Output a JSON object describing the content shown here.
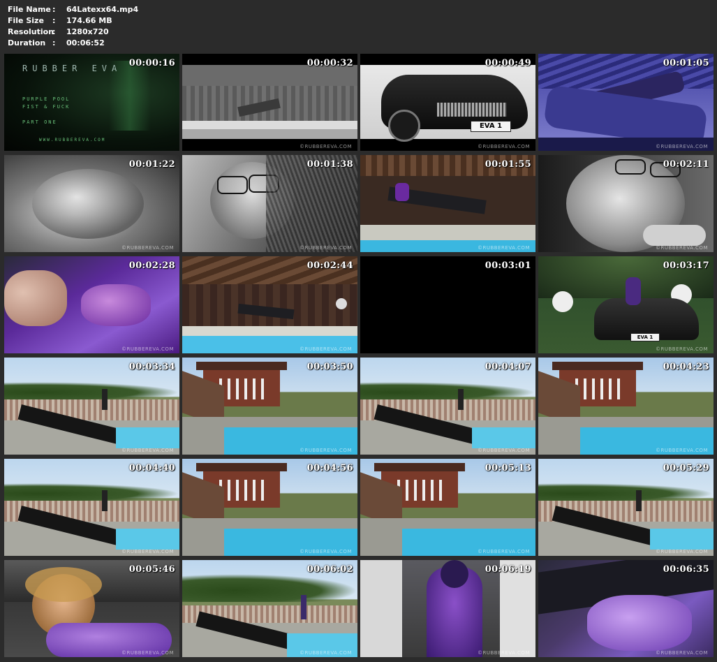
{
  "file_info": {
    "name_label": "File Name",
    "name": "64Latexx64.mp4",
    "size_label": "File Size",
    "size": "174.66 MB",
    "resolution_label": "Resolution",
    "resolution": "1280x720",
    "duration_label": "Duration",
    "duration": "00:06:52",
    "separator": ":"
  },
  "title_card": {
    "title": "RUBBER EVA",
    "subtitle": "PURPLE POOL\nFIST & FUCK\n\nPART ONE",
    "url": "WWW.RUBBEREVA.COM"
  },
  "plate_text": "EVA 1",
  "watermark": "©RUBBEREVA.COM",
  "thumbnails": [
    {
      "time": "00:00:16",
      "scene": "title"
    },
    {
      "time": "00:00:32",
      "scene": "pool-gray"
    },
    {
      "time": "00:00:49",
      "scene": "car-bw"
    },
    {
      "time": "00:01:05",
      "scene": "purple-lounge"
    },
    {
      "time": "00:01:22",
      "scene": "closeup-gray"
    },
    {
      "time": "00:01:38",
      "scene": "face-bw"
    },
    {
      "time": "00:01:55",
      "scene": "pool-purple"
    },
    {
      "time": "00:02:11",
      "scene": "face-bw2"
    },
    {
      "time": "00:02:28",
      "scene": "purple-closeup"
    },
    {
      "time": "00:02:44",
      "scene": "pool-purple2"
    },
    {
      "time": "00:03:01",
      "scene": "black"
    },
    {
      "time": "00:03:17",
      "scene": "car-color"
    },
    {
      "time": "00:03:34",
      "scene": "garden-lounge"
    },
    {
      "time": "00:03:50",
      "scene": "house-pool"
    },
    {
      "time": "00:04:07",
      "scene": "garden-lounge"
    },
    {
      "time": "00:04:23",
      "scene": "house-pool"
    },
    {
      "time": "00:04:40",
      "scene": "garden-lounge"
    },
    {
      "time": "00:04:56",
      "scene": "house-pool"
    },
    {
      "time": "00:05:13",
      "scene": "house-pool"
    },
    {
      "time": "00:05:29",
      "scene": "garden-lounge"
    },
    {
      "time": "00:05:46",
      "scene": "blonde-closeup"
    },
    {
      "time": "00:06:02",
      "scene": "garden-lounge2"
    },
    {
      "time": "00:06:19",
      "scene": "purple-standing"
    },
    {
      "time": "00:06:35",
      "scene": "glove-closeup"
    }
  ]
}
